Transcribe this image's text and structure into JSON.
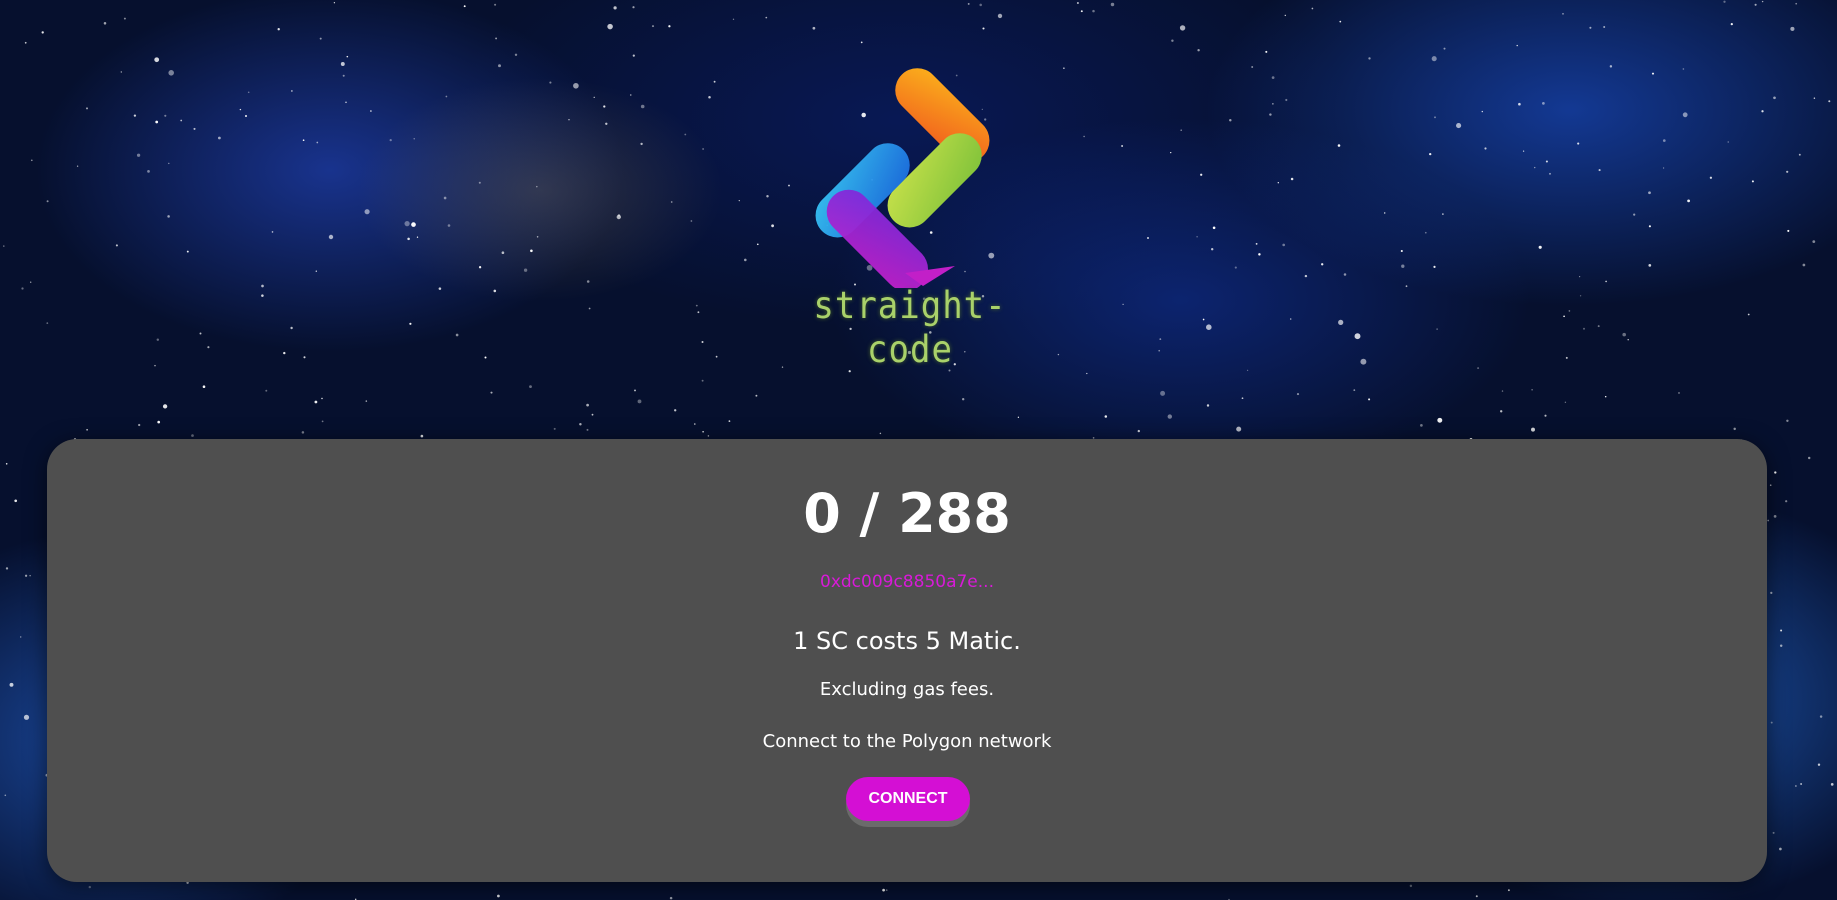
{
  "logo": {
    "text": "straight-code",
    "icon": "straight-code-logo-icon"
  },
  "mint": {
    "counter": "0 / 288",
    "contract_address": "0xdc009c8850a7e...",
    "price_text": "1 SC costs 5 Matic.",
    "gas_note": "Excluding gas fees.",
    "network_prompt": "Connect to the Polygon network",
    "connect_label": "CONNECT"
  },
  "colors": {
    "panel": "#4f4f4f",
    "accent": "#d40fd4",
    "address": "#d81ad8",
    "background": "#06102e"
  }
}
